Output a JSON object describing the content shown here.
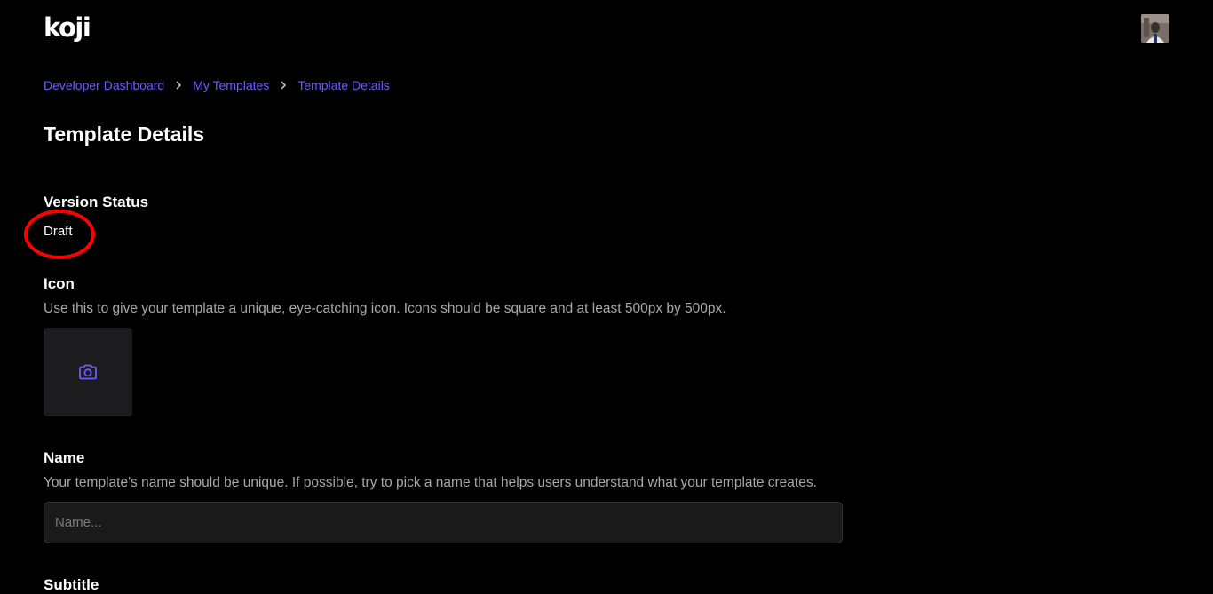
{
  "header": {
    "logo": "koji",
    "avatar_icon": "user-avatar-photo"
  },
  "breadcrumb": {
    "items": [
      "Developer Dashboard",
      "My Templates",
      "Template Details"
    ],
    "separator_icon": "chevron-right-icon"
  },
  "page": {
    "title": "Template Details"
  },
  "version_status": {
    "label": "Version Status",
    "value": "Draft"
  },
  "icon_section": {
    "label": "Icon",
    "description": "Use this to give your template a unique, eye-catching icon. Icons should be square and at least 500px by 500px.",
    "upload_icon": "camera-icon"
  },
  "name_section": {
    "label": "Name",
    "description": "Your template's name should be unique. If possible, try to pick a name that helps users understand what your template creates.",
    "value": "",
    "placeholder": "Name..."
  },
  "subtitle_section": {
    "label": "Subtitle"
  },
  "colors": {
    "background": "#000000",
    "accent": "#6b5cff",
    "annotation": "#ff0000",
    "muted_text": "#a8a8a8",
    "input_bg": "#1a1a1a"
  }
}
